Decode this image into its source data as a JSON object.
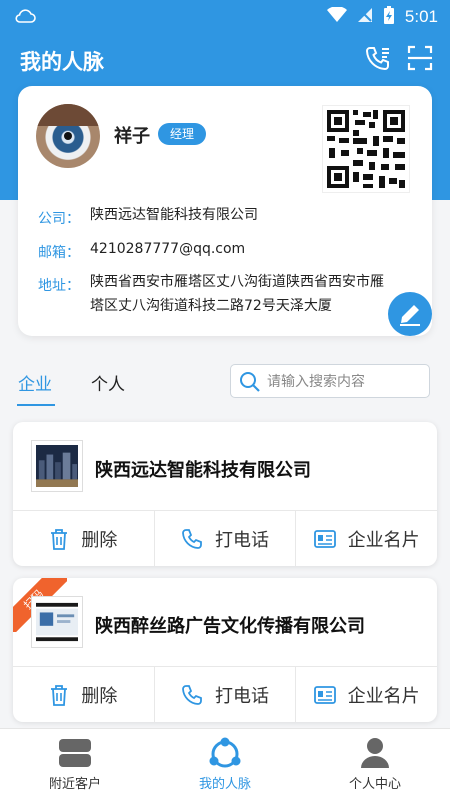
{
  "status_bar": {
    "time": "5:01"
  },
  "header": {
    "title": "我的人脉"
  },
  "profile": {
    "name": "祥子",
    "role": "经理",
    "company_label": "公司：",
    "company": "陕西远达智能科技有限公司",
    "email_label": "邮箱：",
    "email": "4210287777@qq.com",
    "address_label": "地址：",
    "address": "陕西省西安市雁塔区丈八沟街道陕西省西安市雁塔区丈八沟街道科技二路72号天泽大厦"
  },
  "tabs": [
    {
      "label": "企业",
      "active": true
    },
    {
      "label": "个人",
      "active": false
    }
  ],
  "search": {
    "placeholder": "请输入搜索内容",
    "value": ""
  },
  "companies": [
    {
      "name": "陕西远达智能科技有限公司",
      "ribbon": ""
    },
    {
      "name": "陕西醉丝路广告文化传播有限公司",
      "ribbon": "扫码"
    }
  ],
  "card_actions": {
    "delete": "删除",
    "call": "打电话",
    "card": "企业名片"
  },
  "bottom_nav": [
    {
      "label": "附近客户",
      "icon": "nearby-icon",
      "active": false
    },
    {
      "label": "我的人脉",
      "icon": "network-icon",
      "active": true
    },
    {
      "label": "个人中心",
      "icon": "person-icon",
      "active": false
    }
  ],
  "colors": {
    "primary": "#2f96e2",
    "ribbon": "#f0632d"
  }
}
